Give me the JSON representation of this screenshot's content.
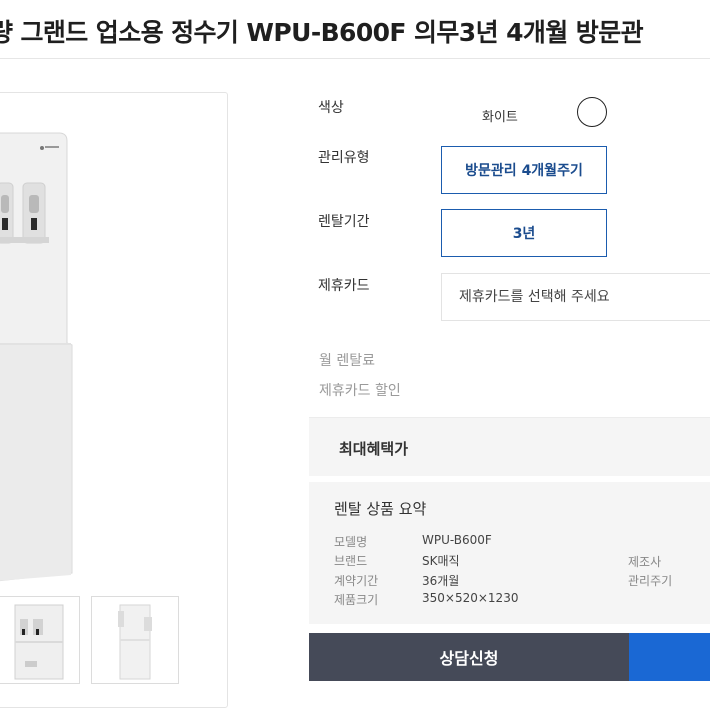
{
  "header": {
    "title": "량 그랜드 업소용 정수기 WPU-B600F 의무3년 4개월 방문관"
  },
  "options": {
    "color_label": "색상",
    "color_value": "화이트",
    "care_label": "관리유형",
    "care_value": "방문관리 4개월주기",
    "period_label": "렌탈기간",
    "period_value": "3년",
    "card_label": "제휴카드",
    "card_placeholder": "제휴카드를 선택해 주세요"
  },
  "fees": {
    "monthly_label": "월 렌탈료",
    "discount_label": "제휴카드 할인"
  },
  "benefit": {
    "label": "최대혜택가"
  },
  "summary": {
    "title": "렌탈 상품 요약",
    "rows": [
      {
        "key": "모델명",
        "value": "WPU-B600F"
      },
      {
        "key": "브랜드",
        "value": "SK매직"
      },
      {
        "key": "계약기간",
        "value": "36개월"
      },
      {
        "key": "제품크기",
        "value": "350×520×1230"
      }
    ],
    "extra_keys": [
      "제조사",
      "관리주기"
    ]
  },
  "actions": {
    "consult_label": "상담신청"
  },
  "colors": {
    "accent_blue": "#1a68d4",
    "button_dark": "#454a58",
    "option_border": "#1b5cae"
  }
}
